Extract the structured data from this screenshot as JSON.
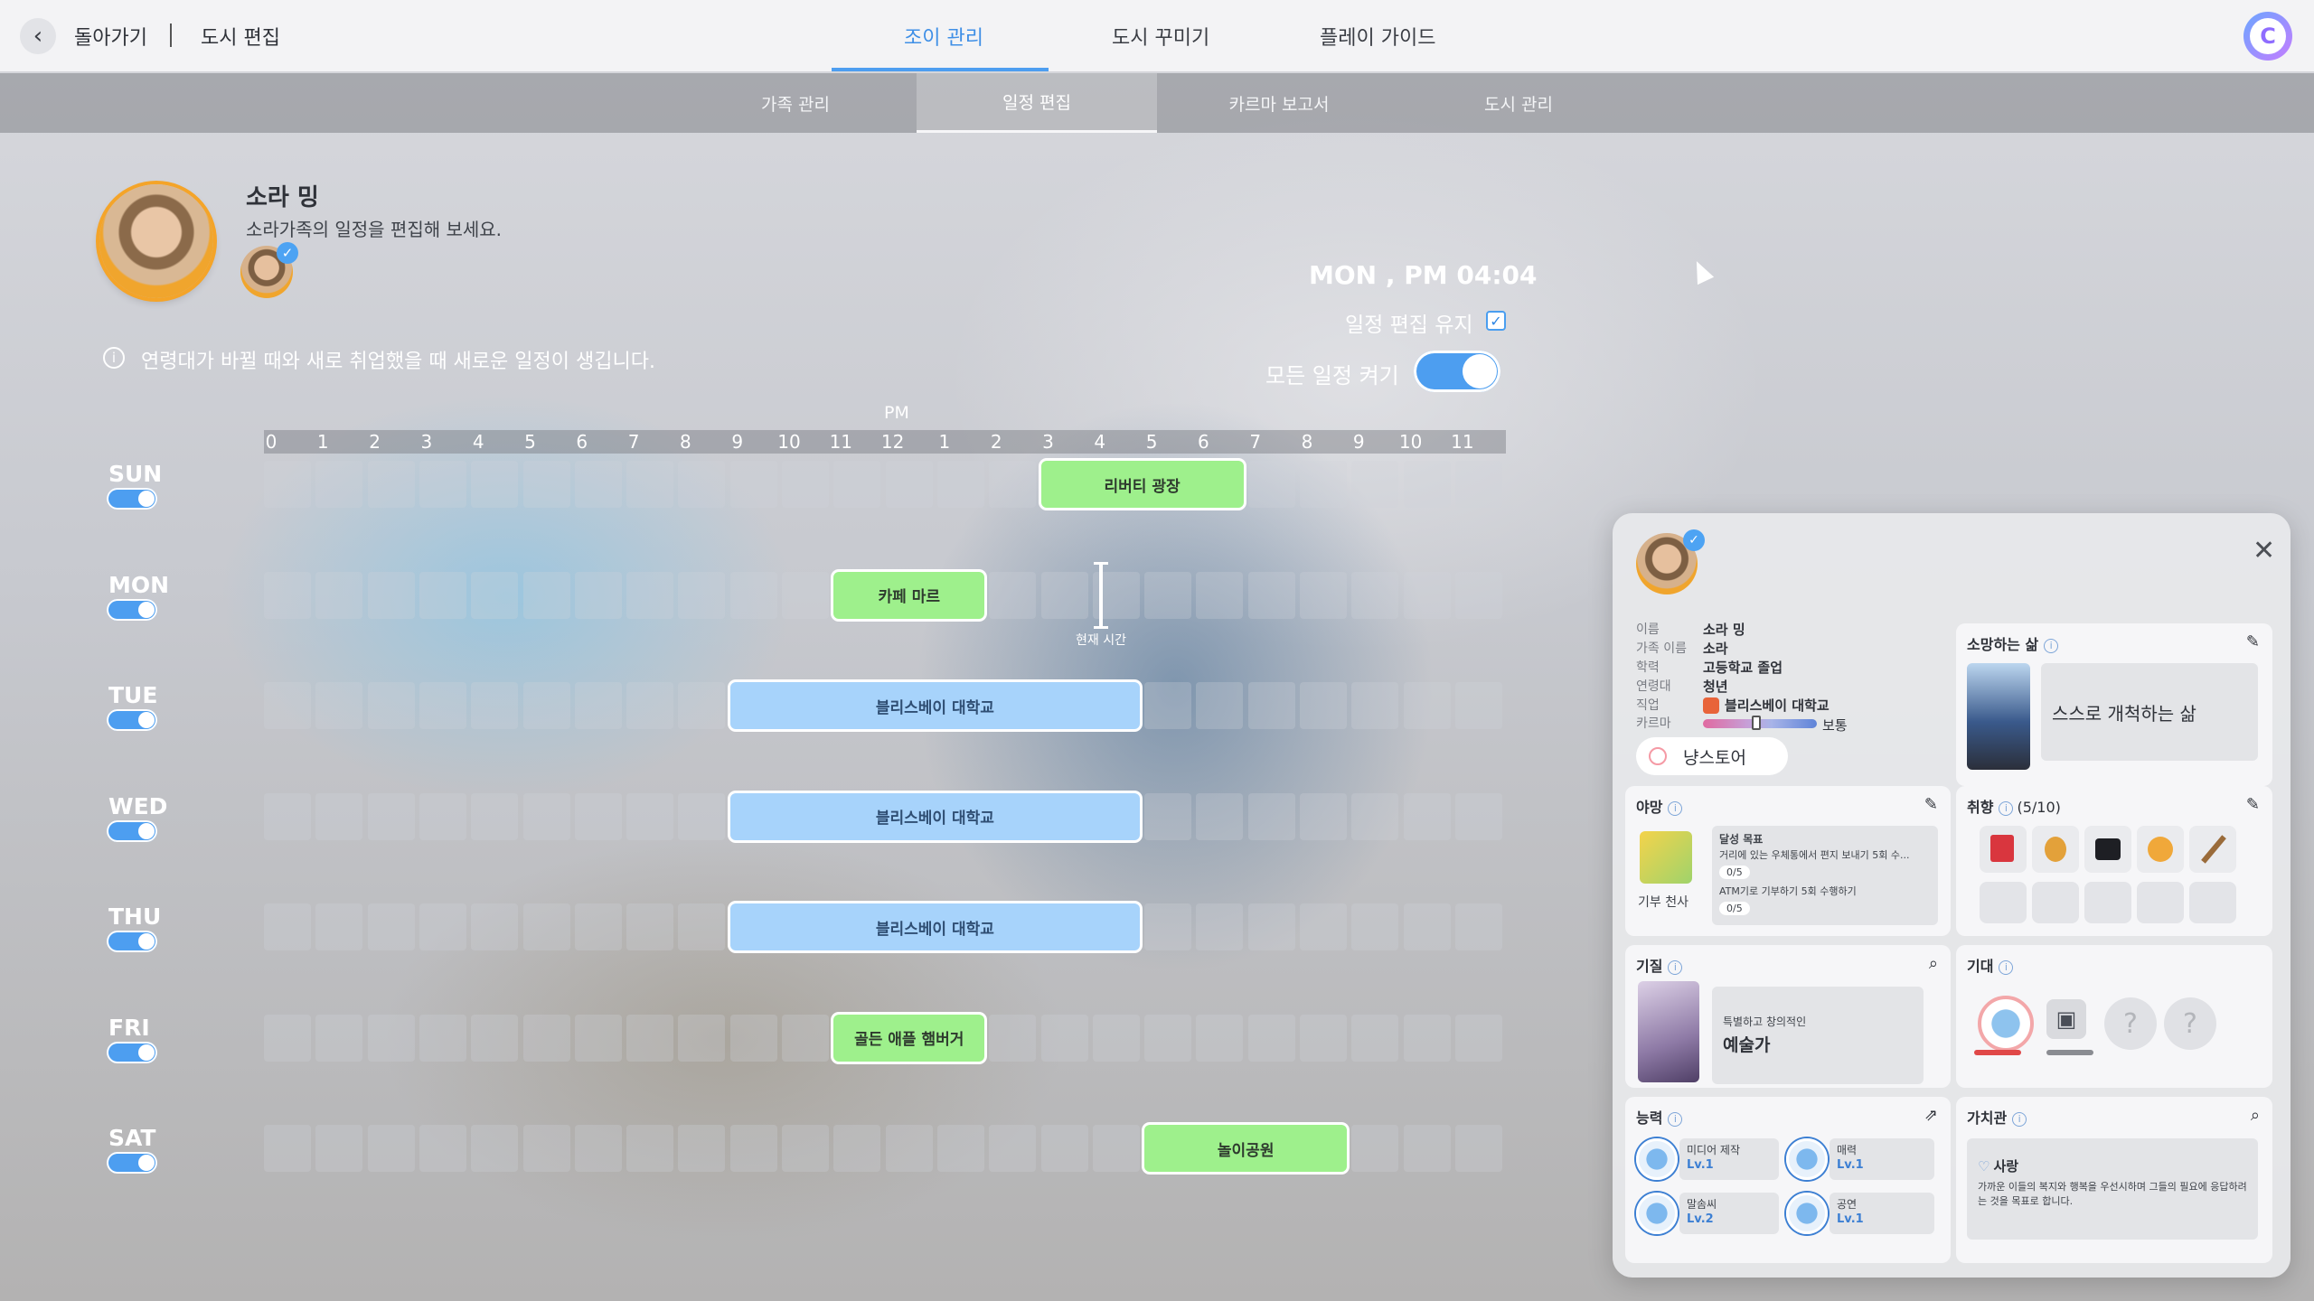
{
  "topbar": {
    "back_label": "돌아가기",
    "city_edit": "도시 편집",
    "tabs": [
      "조이 관리",
      "도시 꾸미기",
      "플레이 가이드"
    ],
    "active_tab": 0,
    "user_initial": "C"
  },
  "subtabs": {
    "items": [
      "가족 관리",
      "일정 편집",
      "카르마 보고서",
      "도시 관리"
    ],
    "active": 1
  },
  "profile": {
    "name": "소라 밍",
    "subtitle": "소라가족의 일정을 편집해 보세요.",
    "info": "연령대가 바뀔 때와 새로 취업했을 때 새로운 일정이 생깁니다."
  },
  "schedule_controls": {
    "time": "MON , PM 04:04",
    "keep_label": "일정 편집 유지",
    "keep_checked": true,
    "all_label": "모든 일정 켜기",
    "all_on": true
  },
  "timeline": {
    "pm_label": "PM",
    "hours": [
      "0",
      "1",
      "2",
      "3",
      "4",
      "5",
      "6",
      "7",
      "8",
      "9",
      "10",
      "11",
      "12",
      "1",
      "2",
      "3",
      "4",
      "5",
      "6",
      "7",
      "8",
      "9",
      "10",
      "11"
    ],
    "now_label": "현재 시간",
    "days": [
      {
        "day": "SUN",
        "enabled": true,
        "events": [
          {
            "name": "리버티 광장",
            "start": 15,
            "end": 19,
            "color": "green"
          }
        ]
      },
      {
        "day": "MON",
        "enabled": true,
        "events": [
          {
            "name": "카페 마르",
            "start": 11,
            "end": 14,
            "color": "green"
          }
        ]
      },
      {
        "day": "TUE",
        "enabled": true,
        "events": [
          {
            "name": "블리스베이 대학교",
            "start": 9,
            "end": 17,
            "color": "blue"
          }
        ]
      },
      {
        "day": "WED",
        "enabled": true,
        "events": [
          {
            "name": "블리스베이 대학교",
            "start": 9,
            "end": 17,
            "color": "blue"
          }
        ]
      },
      {
        "day": "THU",
        "enabled": true,
        "events": [
          {
            "name": "블리스베이 대학교",
            "start": 9,
            "end": 17,
            "color": "blue"
          }
        ]
      },
      {
        "day": "FRI",
        "enabled": true,
        "events": [
          {
            "name": "골든 애플 햄버거",
            "start": 11,
            "end": 14,
            "color": "green"
          }
        ]
      },
      {
        "day": "SAT",
        "enabled": true,
        "events": [
          {
            "name": "놀이공원",
            "start": 17,
            "end": 21,
            "color": "green"
          }
        ]
      }
    ]
  },
  "card": {
    "fields": [
      {
        "k": "이름",
        "v": "소라 밍"
      },
      {
        "k": "가족 이름",
        "v": "소라"
      },
      {
        "k": "학력",
        "v": "고등학교 졸업"
      },
      {
        "k": "연령대",
        "v": "청년"
      },
      {
        "k": "직업",
        "v": "블리스베이 대학교"
      },
      {
        "k": "카르마",
        "v": ""
      }
    ],
    "karma_label": "보통",
    "trait": "냥스토어",
    "dream": {
      "title": "소망하는 삶",
      "value": "스스로 개척하는 삶"
    },
    "ambition": {
      "title": "야망",
      "name": "기부 천사",
      "goal_title": "달성 목표",
      "goal1": "거리에 있는 우체통에서 편지 보내기 5회 수...",
      "goal1_progress": "0/5",
      "goal2": "ATM기로 기부하기 5회 수행하기",
      "goal2_progress": "0/5"
    },
    "hobby": {
      "title": "취향",
      "count": "(5/10)"
    },
    "temper": {
      "title": "기질",
      "desc": "특별하고 창의적인",
      "value": "예술가"
    },
    "expect": {
      "title": "기대"
    },
    "abilities": {
      "title": "능력",
      "items": [
        {
          "name": "미디어 제작",
          "lv": "Lv.1"
        },
        {
          "name": "매력",
          "lv": "Lv.1"
        },
        {
          "name": "말솜씨",
          "lv": "Lv.2"
        },
        {
          "name": "공연",
          "lv": "Lv.1"
        }
      ]
    },
    "values": {
      "title": "가치관",
      "name": "사랑",
      "desc": "가까운 이들의 복지와 행복을 우선시하며 그들의 필요에 응답하려는 것을 목표로 합니다."
    }
  },
  "colors": {
    "accent": "#4d9ef0",
    "event_green": "#9ef08c",
    "event_blue": "#a7d3fb"
  }
}
